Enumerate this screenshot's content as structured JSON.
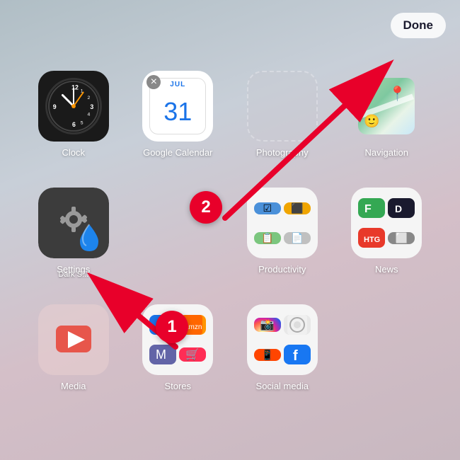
{
  "done_button": "Done",
  "apps": [
    {
      "id": "clock",
      "label": "Clock",
      "type": "clock"
    },
    {
      "id": "google-calendar",
      "label": "Google Calendar",
      "type": "gcal",
      "has_delete": true
    },
    {
      "id": "photography",
      "label": "Photography",
      "type": "empty"
    },
    {
      "id": "navigation",
      "label": "Navigation",
      "type": "maps"
    },
    {
      "id": "settings-dark",
      "label": "Settings",
      "type": "settings_dark",
      "sublabel": "Dark S..."
    },
    {
      "id": "productivity",
      "label": "Productivity",
      "type": "folder_prod"
    },
    {
      "id": "news",
      "label": "News",
      "type": "folder_news"
    },
    {
      "id": "media",
      "label": "Media",
      "type": "folder_media"
    },
    {
      "id": "stores",
      "label": "Stores",
      "type": "folder_stores"
    },
    {
      "id": "social-media",
      "label": "Social media",
      "type": "folder_social"
    }
  ],
  "badge1_label": "1",
  "badge2_label": "2"
}
